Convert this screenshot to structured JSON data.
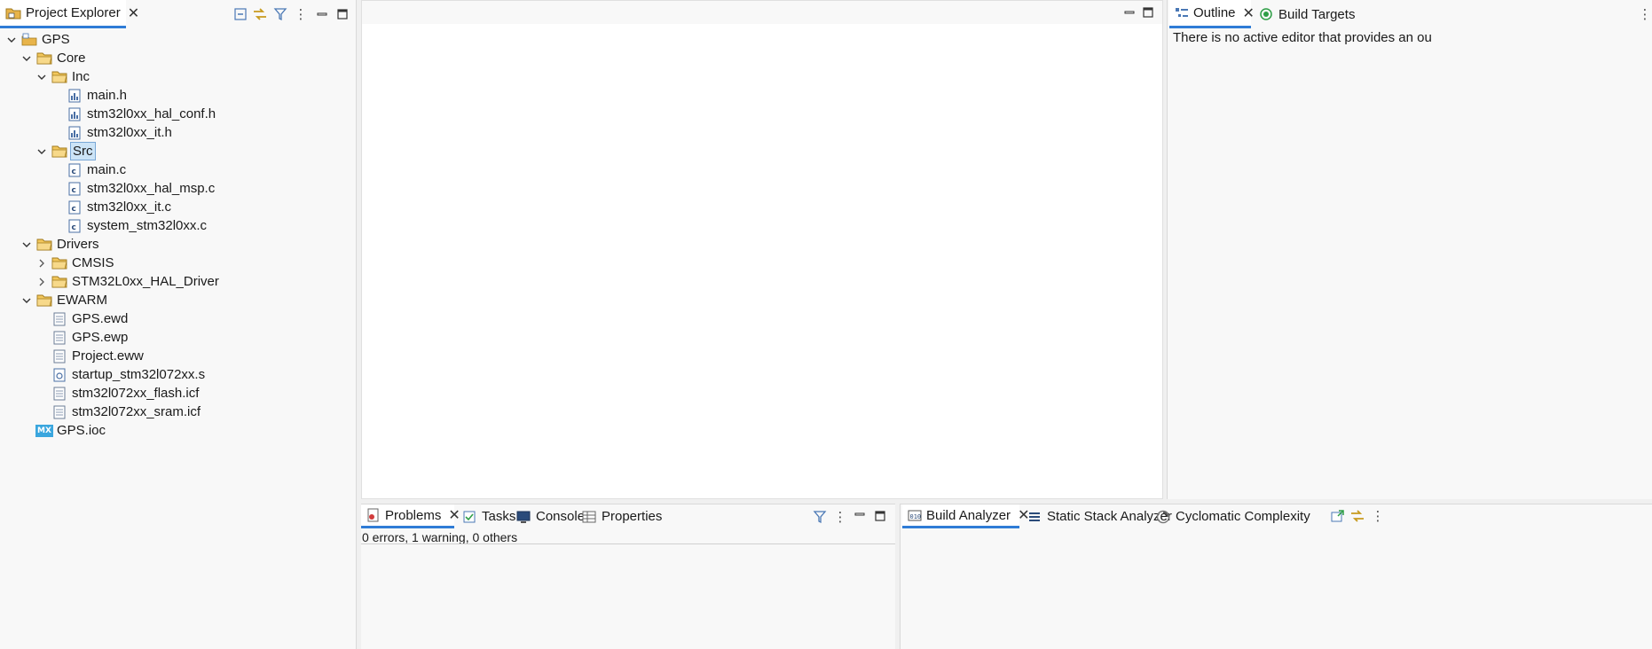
{
  "explorer": {
    "tab_label": "Project Explorer",
    "tree": [
      {
        "label": "GPS",
        "depth": 0,
        "expander": "open",
        "icon": "project-icon"
      },
      {
        "label": "Core",
        "depth": 1,
        "expander": "open",
        "icon": "folder-icon"
      },
      {
        "label": "Inc",
        "depth": 2,
        "expander": "open",
        "icon": "folder-icon"
      },
      {
        "label": "main.h",
        "depth": 3,
        "expander": "none",
        "icon": "header-file-icon"
      },
      {
        "label": "stm32l0xx_hal_conf.h",
        "depth": 3,
        "expander": "none",
        "icon": "header-file-icon"
      },
      {
        "label": "stm32l0xx_it.h",
        "depth": 3,
        "expander": "none",
        "icon": "header-file-icon"
      },
      {
        "label": "Src",
        "depth": 2,
        "expander": "open",
        "icon": "folder-icon",
        "selected": true
      },
      {
        "label": "main.c",
        "depth": 3,
        "expander": "none",
        "icon": "c-file-icon"
      },
      {
        "label": "stm32l0xx_hal_msp.c",
        "depth": 3,
        "expander": "none",
        "icon": "c-file-icon"
      },
      {
        "label": "stm32l0xx_it.c",
        "depth": 3,
        "expander": "none",
        "icon": "c-file-icon"
      },
      {
        "label": "system_stm32l0xx.c",
        "depth": 3,
        "expander": "none",
        "icon": "c-file-icon"
      },
      {
        "label": "Drivers",
        "depth": 1,
        "expander": "open",
        "icon": "folder-icon"
      },
      {
        "label": "CMSIS",
        "depth": 2,
        "expander": "closed",
        "icon": "folder-icon"
      },
      {
        "label": "STM32L0xx_HAL_Driver",
        "depth": 2,
        "expander": "closed",
        "icon": "folder-icon"
      },
      {
        "label": "EWARM",
        "depth": 1,
        "expander": "open",
        "icon": "folder-icon"
      },
      {
        "label": "GPS.ewd",
        "depth": 2,
        "expander": "none",
        "icon": "text-file-icon"
      },
      {
        "label": "GPS.ewp",
        "depth": 2,
        "expander": "none",
        "icon": "text-file-icon"
      },
      {
        "label": "Project.eww",
        "depth": 2,
        "expander": "none",
        "icon": "text-file-icon"
      },
      {
        "label": "startup_stm32l072xx.s",
        "depth": 2,
        "expander": "none",
        "icon": "asm-file-icon"
      },
      {
        "label": "stm32l072xx_flash.icf",
        "depth": 2,
        "expander": "none",
        "icon": "text-file-icon"
      },
      {
        "label": "stm32l072xx_sram.icf",
        "depth": 2,
        "expander": "none",
        "icon": "text-file-icon"
      },
      {
        "label": "GPS.ioc",
        "depth": 1,
        "expander": "none",
        "icon": "mx-file-icon"
      }
    ],
    "mx_badge": "MX"
  },
  "outline": {
    "tabs": [
      {
        "label": "Outline"
      },
      {
        "label": "Build Targets"
      }
    ],
    "message": "There is no active editor that provides an ou"
  },
  "bottom": {
    "tabs": [
      {
        "label": "Problems"
      },
      {
        "label": "Tasks"
      },
      {
        "label": "Console"
      },
      {
        "label": "Properties"
      }
    ],
    "summary": "0 errors, 1 warning, 0 others"
  },
  "analyzer": {
    "tabs": [
      {
        "label": "Build Analyzer"
      },
      {
        "label": "Static Stack Analyzer"
      },
      {
        "label": "Cyclomatic Complexity"
      }
    ]
  },
  "colors": {
    "accent": "#2f7cd6",
    "folder": "#e8b44a",
    "selection": "#cce4f7"
  }
}
